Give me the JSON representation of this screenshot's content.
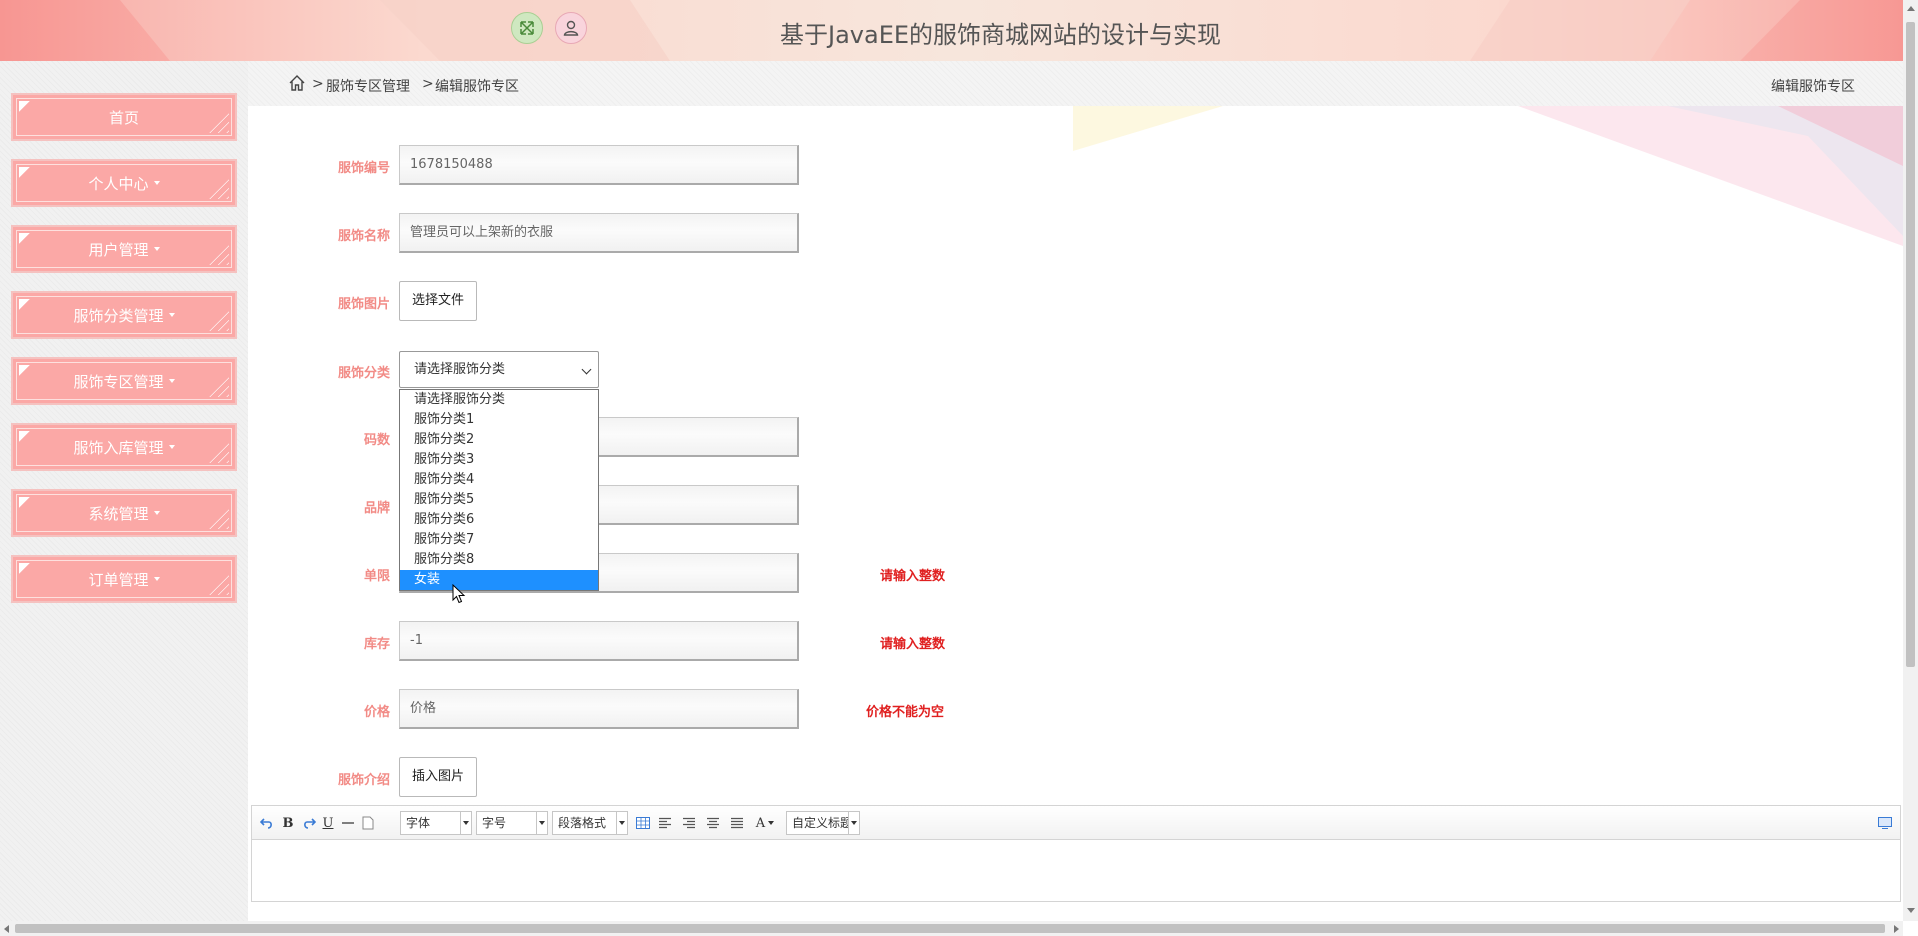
{
  "header": {
    "title": "基于JavaEE的服饰商城网站的设计与实现",
    "fullscreen_icon": "expand-icon",
    "user_icon": "user-icon"
  },
  "sidebar": {
    "items": [
      {
        "label": "首页",
        "has_caret": false
      },
      {
        "label": "个人中心",
        "has_caret": true
      },
      {
        "label": "用户管理",
        "has_caret": true
      },
      {
        "label": "服饰分类管理",
        "has_caret": true
      },
      {
        "label": "服饰专区管理",
        "has_caret": true
      },
      {
        "label": "服饰入库管理",
        "has_caret": true
      },
      {
        "label": "系统管理",
        "has_caret": true
      },
      {
        "label": "订单管理",
        "has_caret": true
      }
    ]
  },
  "breadcrumb": {
    "home_icon": "home-icon",
    "sep": ">",
    "parent": "服饰专区管理",
    "current": "编辑服饰专区",
    "right_title": "编辑服饰专区"
  },
  "form": {
    "code": {
      "label": "服饰编号",
      "value": "1678150488"
    },
    "name": {
      "label": "服饰名称",
      "value": "管理员可以上架新的衣服"
    },
    "image": {
      "label": "服饰图片",
      "button": "选择文件"
    },
    "category": {
      "label": "服饰分类",
      "selected": "请选择服饰分类",
      "options": [
        "请选择服饰分类",
        "服饰分类1",
        "服饰分类2",
        "服饰分类3",
        "服饰分类4",
        "服饰分类5",
        "服饰分类6",
        "服饰分类7",
        "服饰分类8",
        "女装"
      ],
      "highlighted": "女装"
    },
    "size": {
      "label": "码数"
    },
    "brand": {
      "label": "品牌"
    },
    "limit": {
      "label": "单限",
      "error": "请输入整数"
    },
    "stock": {
      "label": "库存",
      "value": "-1",
      "error": "请输入整数"
    },
    "price": {
      "label": "价格",
      "placeholder": "价格",
      "error": "价格不能为空"
    },
    "intro": {
      "label": "服饰介绍",
      "button": "插入图片"
    }
  },
  "editor": {
    "font_combo": "字体",
    "size_combo": "字号",
    "paragraph_combo": "段落格式",
    "custom_title_combo": "自定义标题",
    "bold": "B",
    "underline": "U",
    "font_color": "A"
  },
  "colors": {
    "accent": "#fba8a6",
    "label": "#f28b86",
    "error": "#e02020",
    "selected_option": "#1e90ff"
  }
}
